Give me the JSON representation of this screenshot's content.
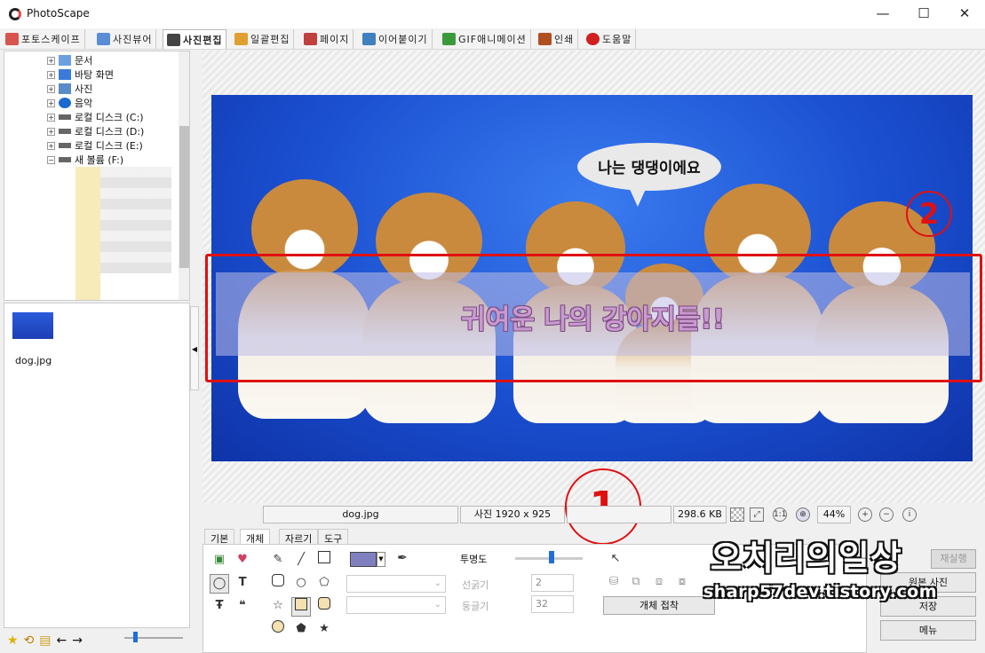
{
  "window": {
    "title": "PhotoScape",
    "minimize": "—",
    "maximize": "☐",
    "close": "✕"
  },
  "main_tabs": [
    {
      "label": "포토스케이프",
      "icon": "photoscape-icon",
      "color": "#d9534f"
    },
    {
      "label": "사진뷰어",
      "icon": "viewer-icon",
      "color": "#5b8dd6"
    },
    {
      "label": "사진편집",
      "icon": "editor-icon",
      "color": "#444"
    },
    {
      "label": "일괄편집",
      "icon": "batch-icon",
      "color": "#e0a030"
    },
    {
      "label": "페이지",
      "icon": "page-icon",
      "color": "#c04040"
    },
    {
      "label": "이어붙이기",
      "icon": "combine-icon",
      "color": "#4080c0"
    },
    {
      "label": "GIF애니메이션",
      "icon": "gif-icon",
      "color": "#3a9a3a"
    },
    {
      "label": "인쇄",
      "icon": "print-icon",
      "color": "#b05020"
    },
    {
      "label": "도움말",
      "icon": "help-icon",
      "color": "#d02020"
    }
  ],
  "tree": {
    "items": [
      {
        "label": "문서",
        "icon": "document-icon",
        "color": "#6aa0e0"
      },
      {
        "label": "바탕 화면",
        "icon": "desktop-icon",
        "color": "#3a7ad8"
      },
      {
        "label": "사진",
        "icon": "pictures-icon",
        "color": "#5a8ac8"
      },
      {
        "label": "음악",
        "icon": "music-icon",
        "color": "#1a6ad0"
      },
      {
        "label": "로컬 디스크 (C:)",
        "icon": "disk-icon",
        "color": "#666"
      },
      {
        "label": "로컬 디스크 (D:)",
        "icon": "disk-icon",
        "color": "#666"
      },
      {
        "label": "로컬 디스크 (E:)",
        "icon": "disk-icon",
        "color": "#666"
      },
      {
        "label": "새 볼륨 (F:)",
        "icon": "disk-icon",
        "color": "#666"
      }
    ]
  },
  "thumbnail": {
    "filename": "dog.jpg"
  },
  "photo": {
    "speech_bubble": "나는 댕댕이에요",
    "caption": "귀여운 나의 강아지들!!"
  },
  "annotations": {
    "marker1": "1",
    "marker2": "2"
  },
  "status_bar": {
    "filename": "dog.jpg",
    "dimensions": "사진 1920 x 925",
    "filesize": "298.6 KB",
    "zoom": "44%"
  },
  "sub_tabs": [
    "기본",
    "개체",
    "자르기",
    "도구"
  ],
  "object_panel": {
    "fill_color": "#8080c0",
    "opacity_label": "투명도",
    "opacity_value": 0.5,
    "line_width_label": "선굵기",
    "line_width_value": "2",
    "roundness_label": "둥글기",
    "roundness_value": "32",
    "attach_button": "개체 접착"
  },
  "right_buttons": {
    "redo": "재실행",
    "original": "원본 사진",
    "save": "저장",
    "menu": "메뉴"
  },
  "watermark": {
    "title": "오치리의일상",
    "url": "sharp57dev.tistory.com"
  },
  "colors": {
    "accent_red": "#e01010",
    "slider_blue": "#1e6fd9"
  }
}
